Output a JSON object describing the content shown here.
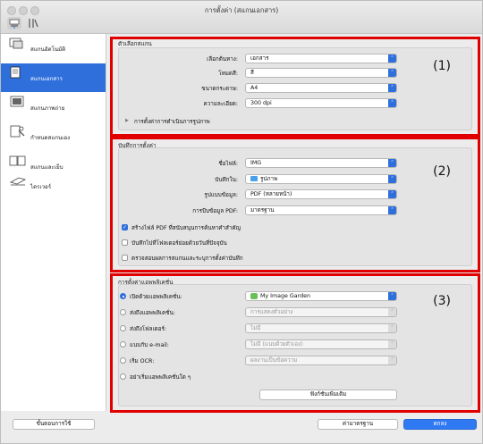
{
  "window": {
    "title": "การตั้งค่า (สแกนเอกสาร)"
  },
  "toolbar": {
    "icons": [
      "scan-settings-icon",
      "general-settings-icon"
    ]
  },
  "sidebar": {
    "items": [
      {
        "label": "สแกนอัตโนมัติ",
        "icon": "auto-scan-icon",
        "selected": false
      },
      {
        "label": "สแกนเอกสาร",
        "icon": "document-scan-icon",
        "selected": true
      },
      {
        "label": "สแกนภาพถ่าย",
        "icon": "photo-scan-icon",
        "selected": false
      },
      {
        "label": "กำหนดสแกนเอง",
        "icon": "custom-scan-icon",
        "selected": false
      },
      {
        "label": "สแกนและเย็บ",
        "icon": "scan-stitch-icon",
        "selected": false
      },
      {
        "label": "ไดรเวอร์",
        "icon": "driver-icon",
        "selected": false
      }
    ]
  },
  "scan_options": {
    "title": "ตัวเลือกสแกน",
    "badge": "(1)",
    "rows": [
      {
        "label": "เลือกต้นทาง:",
        "value": "เอกสาร"
      },
      {
        "label": "โหมดสี:",
        "value": "สี"
      },
      {
        "label": "ขนาดกระดาษ:",
        "value": "A4"
      },
      {
        "label": "ความละเอียด:",
        "value": "300 dpi"
      }
    ],
    "image_processing": "การตั้งค่าการดำเนินการรูปภาพ"
  },
  "save_settings": {
    "title": "บันทึกการตั้งค่า",
    "badge": "(2)",
    "rows": [
      {
        "label": "ชื่อไฟล์:",
        "value": "IMG"
      },
      {
        "label": "บันทึกใน:",
        "value": "รูปภาพ"
      },
      {
        "label": "รูปแบบข้อมูล:",
        "value": "PDF (หลายหน้า)"
      },
      {
        "label": "การบีบข้อมูล PDF:",
        "value": "มาตรฐาน"
      }
    ],
    "checks": [
      {
        "label": "สร้างไฟล์ PDF ที่สนับสนุนการค้นหาคำสำคัญ",
        "checked": true
      },
      {
        "label": "บันทึกไปที่โฟลเดอร์ย่อยด้วยวันที่ปัจจุบัน",
        "checked": false
      },
      {
        "label": "ตรวจสอบผลการสแกนและระบุการตั้งค่าบันทึก",
        "checked": false
      }
    ]
  },
  "app_settings": {
    "title": "การตั้งค่าแอพพลิเคชั่น",
    "badge": "(3)",
    "rows": [
      {
        "label": "เปิดด้วยแอพพลิเคชั่น:",
        "value": "My Image Garden",
        "selected": true,
        "enabled": true
      },
      {
        "label": "ส่งถึงแอพพลิเคชั่น:",
        "value": "การแสดงตัวอย่าง",
        "selected": false,
        "enabled": false
      },
      {
        "label": "ส่งถึงโฟลเดอร์:",
        "value": "ไม่มี",
        "selected": false,
        "enabled": false
      },
      {
        "label": "แนบกับ e-mail:",
        "value": "ไม่มี (แนบด้วยตัวเอง)",
        "selected": false,
        "enabled": false
      },
      {
        "label": "เริ่ม OCR:",
        "value": "ผลงานเป็นข้อความ",
        "selected": false,
        "enabled": false
      },
      {
        "label": "อย่าเริ่มแอพพลิเคชั่นใด ๆ",
        "value": "",
        "selected": false,
        "enabled": false
      }
    ],
    "more_functions": "ฟังก์ชันเพิ่มเติม"
  },
  "footer": {
    "instructions": "ขั้นตอนการใช้",
    "defaults": "ค่ามาตรฐาน",
    "ok": "ตกลง"
  },
  "colors": {
    "accent": "#2f6fdc",
    "highlight_border": "#e00000"
  }
}
